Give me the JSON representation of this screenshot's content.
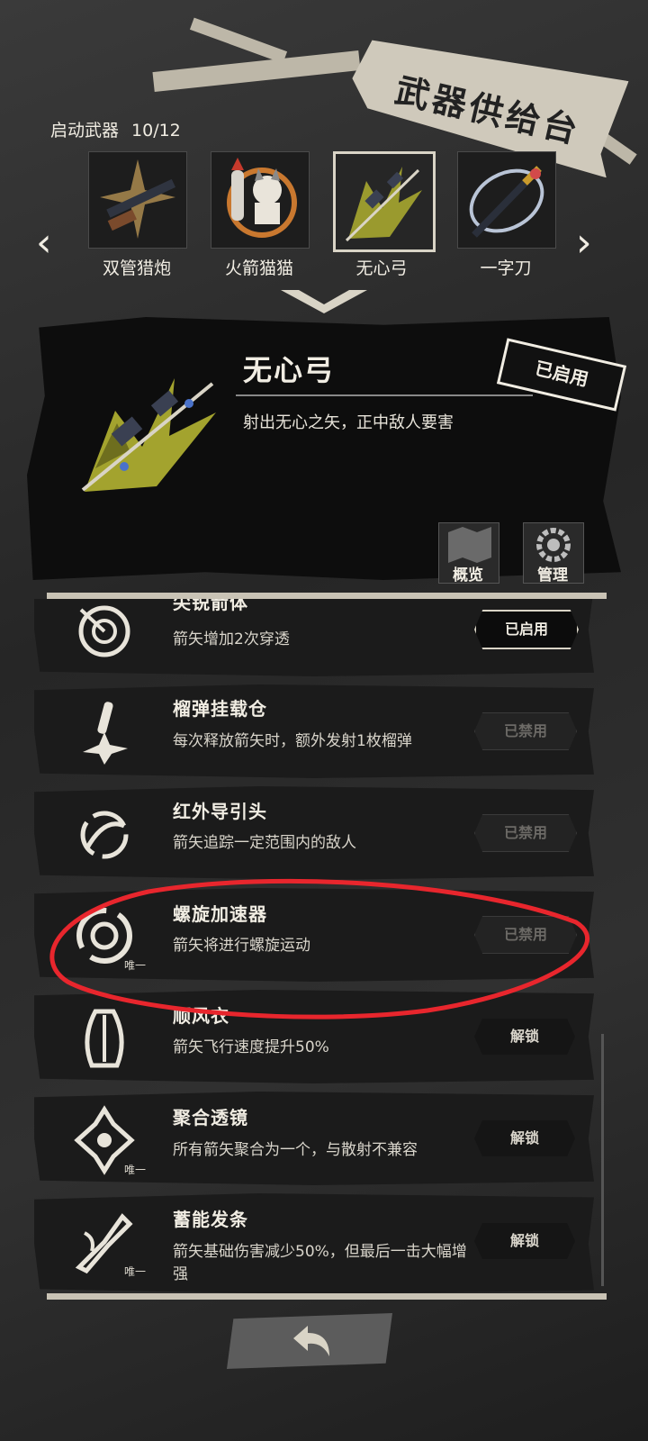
{
  "header": {
    "title": "武器供给台",
    "status_label": "启动武器",
    "status_count": "10/12"
  },
  "carousel": {
    "prev_icon": "chevron-left-icon",
    "next_icon": "chevron-right-icon",
    "weapons": [
      {
        "name": "双管猎炮",
        "icon": "shotgun-icon"
      },
      {
        "name": "火箭猫猫",
        "icon": "rocket-cat-icon"
      },
      {
        "name": "无心弓",
        "icon": "bow-icon",
        "selected": true
      },
      {
        "name": "一字刀",
        "icon": "katana-icon"
      }
    ]
  },
  "detail": {
    "name": "无心弓",
    "description": "射出无心之矢，正中敌人要害",
    "status_stamp": "已启用",
    "overview_label": "概览",
    "manage_label": "管理"
  },
  "modules": [
    {
      "title": "尖锐箭体",
      "description": "箭矢增加2次穿透",
      "button": "已启用",
      "state": "enabled",
      "icon": "target-icon",
      "tag": ""
    },
    {
      "title": "榴弹挂载仓",
      "description": "每次释放箭矢时，额外发射1枚榴弹",
      "button": "已禁用",
      "state": "disabled",
      "icon": "grenade-icon",
      "tag": ""
    },
    {
      "title": "红外导引头",
      "description": "箭矢追踪一定范围内的敌人",
      "button": "已禁用",
      "state": "disabled",
      "icon": "homing-icon",
      "tag": ""
    },
    {
      "title": "螺旋加速器",
      "description": "箭矢将进行螺旋运动",
      "button": "已禁用",
      "state": "disabled",
      "icon": "spiral-icon",
      "tag": "唯一"
    },
    {
      "title": "顺风衣",
      "description": "箭矢飞行速度提升50%",
      "button": "解锁",
      "state": "locked",
      "icon": "wind-icon",
      "tag": ""
    },
    {
      "title": "聚合透镜",
      "description": "所有箭矢聚合为一个，与散射不兼容",
      "button": "解锁",
      "state": "locked",
      "icon": "lens-icon",
      "tag": "唯一"
    },
    {
      "title": "蓄能发条",
      "description": "箭矢基础伤害减少50%，但最后一击大幅增强",
      "button": "解锁",
      "state": "locked",
      "icon": "charge-icon",
      "tag": "唯一"
    }
  ],
  "footer": {
    "back_icon": "back-arrow-icon"
  },
  "colors": {
    "background": "#2b2b2b",
    "panel": "#0d0d0d",
    "accent": "#d9d4c6",
    "annotation": "#e8262d"
  }
}
